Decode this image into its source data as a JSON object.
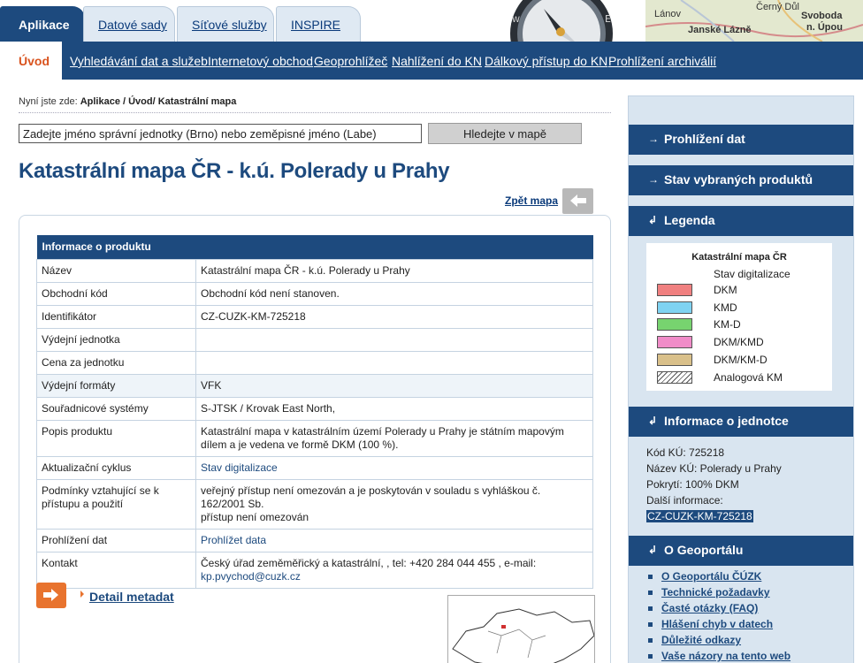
{
  "tabs": [
    "Aplikace",
    "Datové sady",
    "Síťové služby",
    "INSPIRE"
  ],
  "map_strip": [
    "Černý Důl",
    "Lánov",
    "Janské Lázně",
    "Svoboda",
    "n. Úpou"
  ],
  "subnav": {
    "home": "Úvod",
    "items": [
      "Vyhledávání dat a služeb",
      "Internetový obchod",
      "Geoprohlížeč",
      "Nahlížení do KN",
      "Dálkový přístup do KN",
      "Prohlížení archiválií"
    ]
  },
  "breadcrumb": {
    "prefix": "Nyní jste zde:",
    "path": "Aplikace / Úvod/ Katastrální mapa"
  },
  "search": {
    "placeholder": "Zadejte jméno správní jednotky (Brno) nebo zeměpisné jméno (Labe)",
    "button": "Hledejte v mapě"
  },
  "title": "Katastrální mapa ČR - k.ú. Polerady u Prahy",
  "back_link": "Zpět mapa",
  "product": {
    "header": "Informace o produktu",
    "rows": [
      {
        "key": "Název",
        "value": "Katastrální mapa ČR - k.ú. Polerady u Prahy"
      },
      {
        "key": "Obchodní kód",
        "value": "Obchodní kód není stanoven."
      },
      {
        "key": "Identifikátor",
        "value": "CZ-CUZK-KM-725218"
      },
      {
        "key": "Výdejní jednotka",
        "value": ""
      },
      {
        "key": "Cena za jednotku",
        "value": ""
      },
      {
        "key": "Výdejní formáty",
        "value": "VFK"
      },
      {
        "key": "Souřadnicové systémy",
        "value": "S-JTSK / Krovak East North,"
      },
      {
        "key": "Popis produktu",
        "value": "Katastrální mapa v katastrálním území Polerady u Prahy je státním mapovým dílem a je vedena ve formě DKM (100 %)."
      },
      {
        "key": "Aktualizační cyklus",
        "value": "Stav digitalizace"
      },
      {
        "key": "Podmínky vztahující se k přístupu a použití",
        "value": "veřejný přístup není omezován a je poskytován v souladu s vyhláškou č. 162/2001 Sb.",
        "value2": "přístup není omezován"
      },
      {
        "key": "Prohlížení dat",
        "value": "Prohlížet data"
      },
      {
        "key": "Kontakt",
        "value": "Český úřad zeměměřický a katastrální, , tel: +420 284 044 455 , e-mail:",
        "value2": "kp.pvychod@cuzk.cz"
      }
    ]
  },
  "detail_link": "Detail metadat",
  "sidebar": {
    "browse": "Prohlížení dat",
    "state": "Stav vybraných produktů",
    "legend_title": "Legenda",
    "legend": {
      "title": "Katastrální mapa ČR",
      "subtitle": "Stav digitalizace",
      "items": [
        {
          "label": "DKM",
          "color": "#f08080"
        },
        {
          "label": "KMD",
          "color": "#7fd3f2"
        },
        {
          "label": "KM-D",
          "color": "#77d36f"
        },
        {
          "label": "DKM/KMD",
          "color": "#f08cc8"
        },
        {
          "label": "DKM/KM-D",
          "color": "#d9c08a"
        },
        {
          "label": "Analogová KM",
          "color": "hatch"
        }
      ]
    },
    "unit_title": "Informace o jednotce",
    "unit": {
      "code": "Kód KÚ: 725218",
      "name": "Název KÚ: Polerady u Prahy",
      "coverage": "Pokrytí: 100% DKM",
      "more": "Další informace:",
      "id": "CZ-CUZK-KM-725218"
    },
    "about_title": "O Geoportálu",
    "links": [
      "O Geoportálu ČÚZK",
      "Technické požadavky",
      "Časté otázky (FAQ)",
      "Hlášení chyb v datech",
      "Důležité odkazy",
      "Vaše názory na tento web"
    ]
  }
}
